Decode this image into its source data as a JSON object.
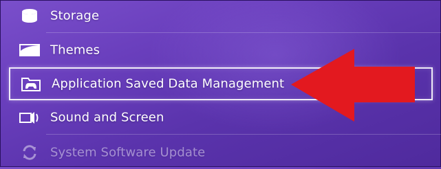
{
  "menu": {
    "items": [
      {
        "label": "Storage",
        "icon": "storage-icon"
      },
      {
        "label": "Themes",
        "icon": "themes-icon"
      },
      {
        "label": "Application Saved Data Management",
        "icon": "folder-gamepad-icon",
        "selected": true
      },
      {
        "label": "Sound and Screen",
        "icon": "speaker-icon"
      },
      {
        "label": "System Software Update",
        "icon": "update-icon"
      }
    ]
  },
  "colors": {
    "background_top": "#7a4fcb",
    "background_bottom": "#4f2a9d",
    "arrow": "#e3191f",
    "text": "#ffffff"
  }
}
